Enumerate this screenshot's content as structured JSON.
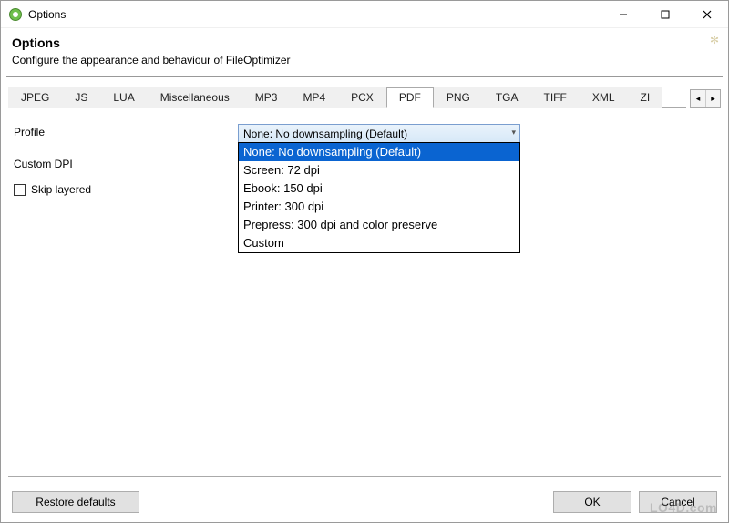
{
  "window": {
    "title": "Options"
  },
  "header": {
    "title": "Options",
    "subtitle": "Configure the appearance and behaviour of FileOptimizer"
  },
  "tabs": [
    {
      "label": "JPEG"
    },
    {
      "label": "JS"
    },
    {
      "label": "LUA"
    },
    {
      "label": "Miscellaneous"
    },
    {
      "label": "MP3"
    },
    {
      "label": "MP4"
    },
    {
      "label": "PCX"
    },
    {
      "label": "PDF"
    },
    {
      "label": "PNG"
    },
    {
      "label": "TGA"
    },
    {
      "label": "TIFF"
    },
    {
      "label": "XML"
    },
    {
      "label": "ZI"
    }
  ],
  "active_tab_index": 7,
  "pdf": {
    "profile_label": "Profile",
    "profile_value": "None: No downsampling (Default)",
    "custom_dpi_label": "Custom DPI",
    "skip_layered_label": "Skip layered",
    "skip_layered_checked": false,
    "dropdown_open": true,
    "dropdown_selected_index": 0,
    "options": [
      "None: No downsampling (Default)",
      "Screen: 72 dpi",
      "Ebook: 150 dpi",
      "Printer: 300 dpi",
      "Prepress: 300 dpi and color preserve",
      "Custom"
    ]
  },
  "buttons": {
    "restore": "Restore defaults",
    "ok": "OK",
    "cancel": "Cancel"
  },
  "scroll_arrows": {
    "left": "◂",
    "right": "▸"
  },
  "watermark": "LO4D.com"
}
